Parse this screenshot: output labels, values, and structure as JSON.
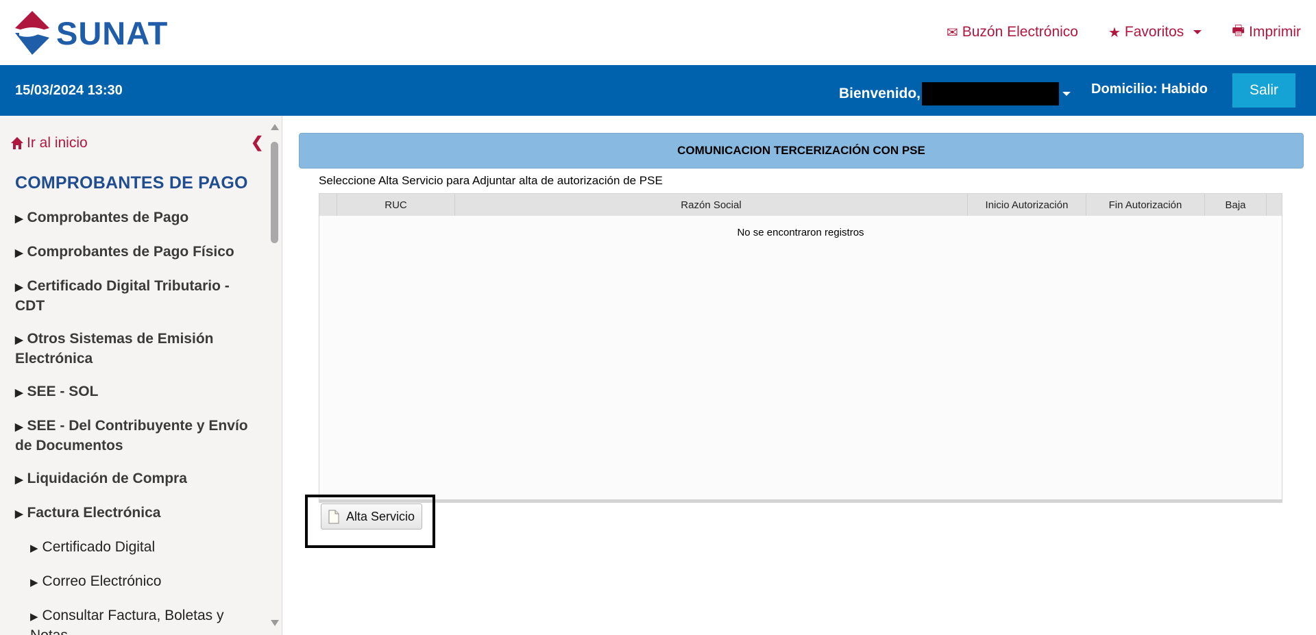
{
  "brand": {
    "name": "SUNAT",
    "primary_color": "#0061ad",
    "accent_color": "#b0173f"
  },
  "header": {
    "links": [
      {
        "label": "Buzón Electrónico",
        "icon": "envelope-icon"
      },
      {
        "label": "Favoritos",
        "icon": "star-icon",
        "has_dropdown": true
      },
      {
        "label": "Imprimir",
        "icon": "printer-icon"
      }
    ]
  },
  "topbar": {
    "datetime": "15/03/2024 13:30",
    "welcome": "Bienvenido,",
    "domicilio": "Domicilio: Habido",
    "logout_label": "Salir"
  },
  "sidebar": {
    "home_label": "Ir al inicio",
    "section_title": "COMPROBANTES DE PAGO",
    "items": [
      {
        "label": "Comprobantes de Pago",
        "level": 1
      },
      {
        "label": "Comprobantes de Pago Físico",
        "level": 1
      },
      {
        "label": "Certificado Digital Tributario - CDT",
        "level": 1
      },
      {
        "label": "Otros Sistemas de Emisión Electrónica",
        "level": 1
      },
      {
        "label": "SEE - SOL",
        "level": 1
      },
      {
        "label": "SEE - Del Contribuyente y Envío de Documentos",
        "level": 1
      },
      {
        "label": "Liquidación de Compra",
        "level": 1
      },
      {
        "label": "Factura Electrónica",
        "level": 1
      },
      {
        "label": "Certificado Digital",
        "level": 2
      },
      {
        "label": "Correo Electrónico",
        "level": 2
      },
      {
        "label": "Consultar Factura, Boletas y Notas",
        "level": 2
      }
    ]
  },
  "main": {
    "panel_title": "COMUNICACION TERCERIZACIÓN CON PSE",
    "instruction": "Seleccione Alta Servicio para Adjuntar alta de autorización de PSE",
    "table": {
      "columns": [
        "RUC",
        "Razón Social",
        "Inicio Autorización",
        "Fin Autorización",
        "Baja"
      ],
      "rows": [],
      "empty_message": "No se encontraron registros"
    },
    "action_button": "Alta Servicio"
  }
}
